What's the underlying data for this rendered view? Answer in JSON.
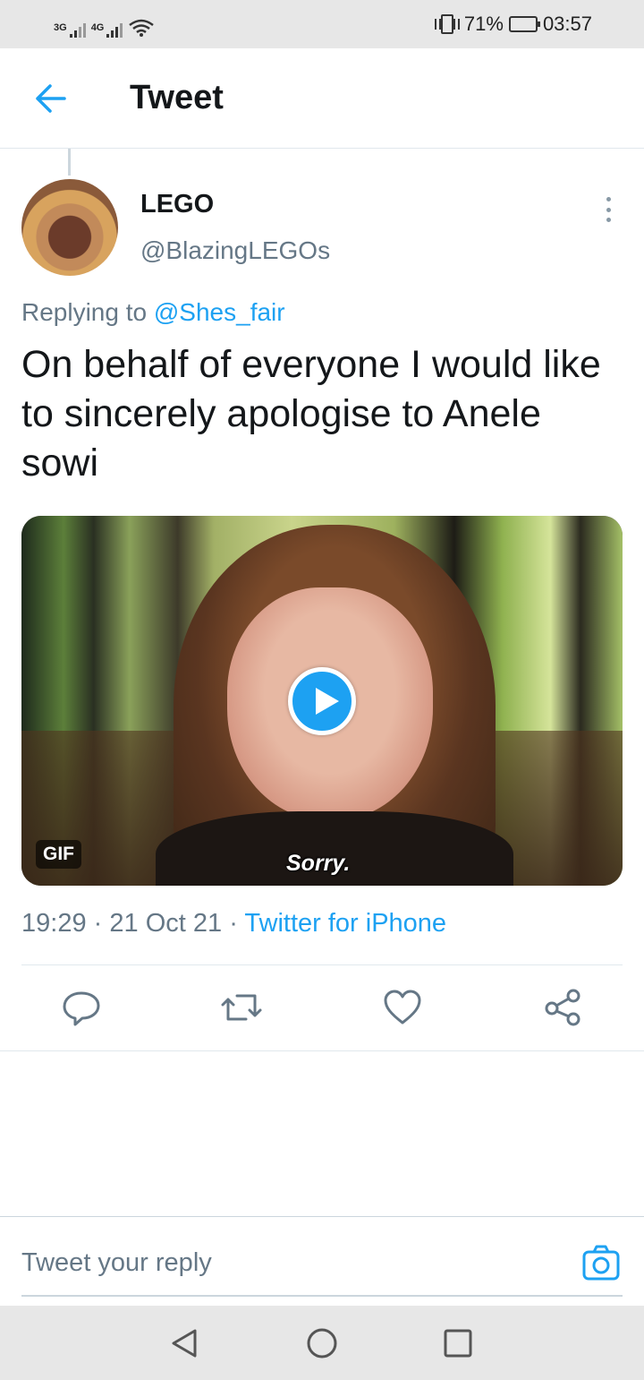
{
  "status_bar": {
    "signal1": "3G",
    "signal2": "4G",
    "battery": "71%",
    "time": "03:57"
  },
  "header": {
    "title": "Tweet",
    "back_icon": "arrow-left-icon"
  },
  "tweet": {
    "display_name": "LEGO",
    "handle": "@BlazingLEGOs",
    "replying_prefix": "Replying to",
    "replying_to": "@Shes_fair",
    "text": "On behalf of everyone I would like to sincerely apologise to Anele sowi",
    "media": {
      "badge": "GIF",
      "caption": "Sorry."
    },
    "time": "19:29",
    "date": "21 Oct 21",
    "source": "Twitter for iPhone",
    "sep": "·"
  },
  "actions": [
    "reply-icon",
    "retweet-icon",
    "like-icon",
    "share-icon"
  ],
  "reply": {
    "placeholder": "Tweet your reply"
  },
  "colors": {
    "accent": "#1da1f2",
    "secondary_text": "#657786",
    "primary_text": "#14171a"
  }
}
